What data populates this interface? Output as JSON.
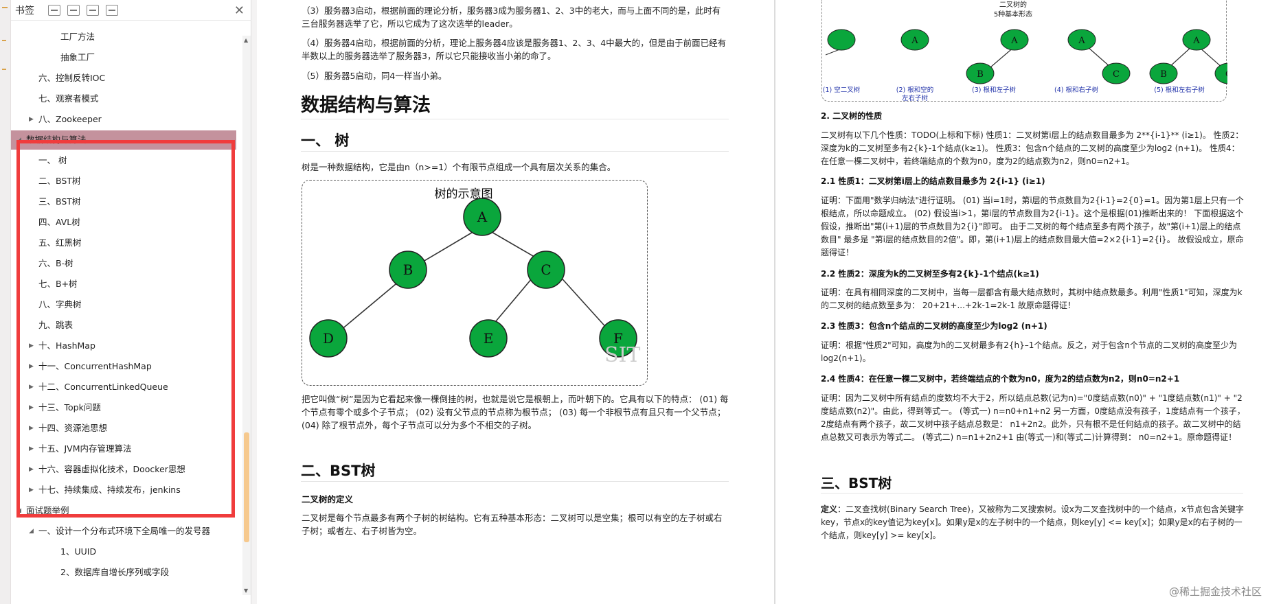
{
  "panel": {
    "title": "书签",
    "close_glyph": "✕",
    "tree": [
      {
        "label": "工厂方法",
        "level": 3,
        "arrow": ""
      },
      {
        "label": "抽象工厂",
        "level": 3,
        "arrow": ""
      },
      {
        "label": "六、控制反转IOC",
        "level": 2,
        "arrow": ""
      },
      {
        "label": "七、观察者模式",
        "level": 2,
        "arrow": ""
      },
      {
        "label": "八、Zookeeper",
        "level": 2,
        "arrow": "▶"
      },
      {
        "label": "数据结构与算法",
        "level": 1,
        "arrow": "◢",
        "selected": true
      },
      {
        "label": "一、 树",
        "level": 2,
        "arrow": ""
      },
      {
        "label": "二、BST树",
        "level": 2,
        "arrow": ""
      },
      {
        "label": "三、BST树",
        "level": 2,
        "arrow": ""
      },
      {
        "label": "四、AVL树",
        "level": 2,
        "arrow": ""
      },
      {
        "label": "五、红黑树",
        "level": 2,
        "arrow": ""
      },
      {
        "label": "六、B-树",
        "level": 2,
        "arrow": ""
      },
      {
        "label": "七、B+树",
        "level": 2,
        "arrow": ""
      },
      {
        "label": "八、字典树",
        "level": 2,
        "arrow": ""
      },
      {
        "label": "九、跳表",
        "level": 2,
        "arrow": ""
      },
      {
        "label": "十、HashMap",
        "level": 2,
        "arrow": "▶"
      },
      {
        "label": "十一、ConcurrentHashMap",
        "level": 2,
        "arrow": "▶"
      },
      {
        "label": "十二、ConcurrentLinkedQueue",
        "level": 2,
        "arrow": "▶"
      },
      {
        "label": "十三、Topk问题",
        "level": 2,
        "arrow": "▶"
      },
      {
        "label": "十四、资源池思想",
        "level": 2,
        "arrow": "▶"
      },
      {
        "label": "十五、JVM内存管理算法",
        "level": 2,
        "arrow": "▶"
      },
      {
        "label": "十六、容器虚拟化技术，Doocker思想",
        "level": 2,
        "arrow": "▶"
      },
      {
        "label": "十七、持续集成、持续发布，jenkins",
        "level": 2,
        "arrow": "▶"
      },
      {
        "label": "面试题举例",
        "level": 1,
        "arrow": "◢"
      },
      {
        "label": "一、设计一个分布式环境下全局唯一的发号器",
        "level": 2,
        "arrow": "◢"
      },
      {
        "label": "1、UUID",
        "level": 3,
        "arrow": ""
      },
      {
        "label": "2、数据库自增长序列或字段",
        "level": 3,
        "arrow": ""
      }
    ]
  },
  "page1": {
    "p_server3": "（3）服务器3启动，根据前面的理论分析，服务器3成为服务器1、2、3中的老大，而与上面不同的是，此时有三台服务器选举了它，所以它成为了这次选举的leader。",
    "p_server4": "（4）服务器4启动，根据前面的分析，理论上服务器4应该是服务器1、2、3、4中最大的，但是由于前面已经有半数以上的服务器选举了服务器3，所以它只能接收当小弟的命了。",
    "p_server5": "（5）服务器5启动，同4一样当小弟。",
    "h1_dsa": "数据结构与算法",
    "h2_tree": "一、 树",
    "p_tree_def": "树是一种数据结构，它是由n（n>=1）个有限节点组成一个具有层次关系的集合。",
    "fig_title": "树的示意图",
    "nodes": [
      "A",
      "B",
      "C",
      "D",
      "E",
      "F"
    ],
    "fig_watermark": "SIT",
    "p_tree_desc": "把它叫做“树”是因为它看起来像一棵倒挂的树，也就是说它是根朝上，而叶朝下的。它具有以下的特点： (01) 每个节点有零个或多个子节点； (02) 没有父节点的节点称为根节点； (03) 每一个非根节点有且只有一个父节点； (04) 除了根节点外，每个子节点可以分为多个不相交的子树。",
    "h2_bst": "二、BST树",
    "h3_bin_def": "二叉树的定义",
    "p_bin_def": "二叉树是每个节点最多有两个子树的树结构。它有五种基本形态：二叉树可以是空集；根可以有空的左子树或右子树；或者左、右子树皆为空。"
  },
  "page2": {
    "fig_title": "二叉树的\n5种基本形态",
    "fig_captions": [
      "(1) 空二叉树",
      "(2) 根和空的\n左右子树",
      "(3) 根和左子树",
      "(4) 根和右子树",
      "(5) 根和左右子树"
    ],
    "h3_props": "2. 二叉树的性质",
    "p_props": "二叉树有以下几个性质：TODO(上标和下标) 性质1：二叉树第i层上的结点数目最多为 2**{i-1}** (i≥1)。 性质2：深度为k的二叉树至多有2{k}-1个结点(k≥1)。 性质3：包含n个结点的二叉树的高度至少为log2 (n+1)。 性质4：在任意一棵二叉树中，若终端结点的个数为n0，度为2的结点数为n2，则n0=n2+1。",
    "h3_p1": "2.1 性质1：二叉树第i层上的结点数目最多为 2{i-1} (i≥1)",
    "p_p1": "证明：下面用\"数学归纳法\"进行证明。 (01) 当i=1时，第i层的节点数目为2{i-1}=2{0}=1。因为第1层上只有一个根结点，所以命题成立。 (02) 假设当i>1，第i层的节点数目为2{i-1}。这个是根据(01)推断出来的！ 下面根据这个假设，推断出\"第(i+1)层的节点数目为2{i}\"即可。 由于二叉树的每个结点至多有两个孩子，故\"第(i+1)层上的结点数目\" 最多是 \"第i层的结点数目的2倍\"。即，第(i+1)层上的结点数目最大值=2×2{i-1}=2{i}。 故假设成立，原命题得证！",
    "h3_p2": "2.2 性质2：深度为k的二叉树至多有2{k}-1个结点(k≥1)",
    "p_p2": "证明：在具有相同深度的二叉树中，当每一层都含有最大结点数时，其树中结点数最多。利用\"性质1\"可知，深度为k的二叉树的结点数至多为： 20+21+...+2k-1=2k-1 故原命题得证！",
    "h3_p3": "2.3 性质3：包含n个结点的二叉树的高度至少为log2 (n+1)",
    "p_p3": "证明：根据\"性质2\"可知，高度为h的二叉树最多有2{h}–1个结点。反之，对于包含n个节点的二叉树的高度至少为log2(n+1)。",
    "h3_p4": "2.4 性质4：在任意一棵二叉树中，若终端结点的个数为n0，度为2的结点数为n2，则n0=n2+1",
    "p_p4": "证明：因为二叉树中所有结点的度数均不大于2，所以结点总数(记为n)=\"0度结点数(n0)\" + \"1度结点数(n1)\" + \"2度结点数(n2)\"。由此，得到等式一。 (等式一) n=n0+n1+n2  另一方面，0度结点没有孩子，1度结点有一个孩子，2度结点有两个孩子，故二叉树中孩子结点总数是： n1+2n2。此外，只有根不是任何结点的孩子。故二叉树中的结点总数又可表示为等式二。 (等式二) n=n1+2n2+1 由(等式一)和(等式二)计算得到： n0=n2+1。原命题得证！",
    "h2_bst": "三、BST树",
    "p_bst_def_label": "定义",
    "p_bst_def": "：二叉查找树(Binary Search Tree)，又被称为二叉搜索树。设x为二叉查找树中的一个结点，x节点包含关键字key，节点x的key值记为key[x]。如果y是x的左子树中的一个结点，则key[y] <= key[x]；如果y是x的右子树的一个结点，则key[y] >= key[x]。",
    "watermark": "@稀土掘金技术社区"
  },
  "colors": {
    "node_fill": "#0aa63c",
    "selected_row": "#c4929d",
    "highlight_box": "#f03c3c",
    "caption_blue": "#2233aa"
  }
}
